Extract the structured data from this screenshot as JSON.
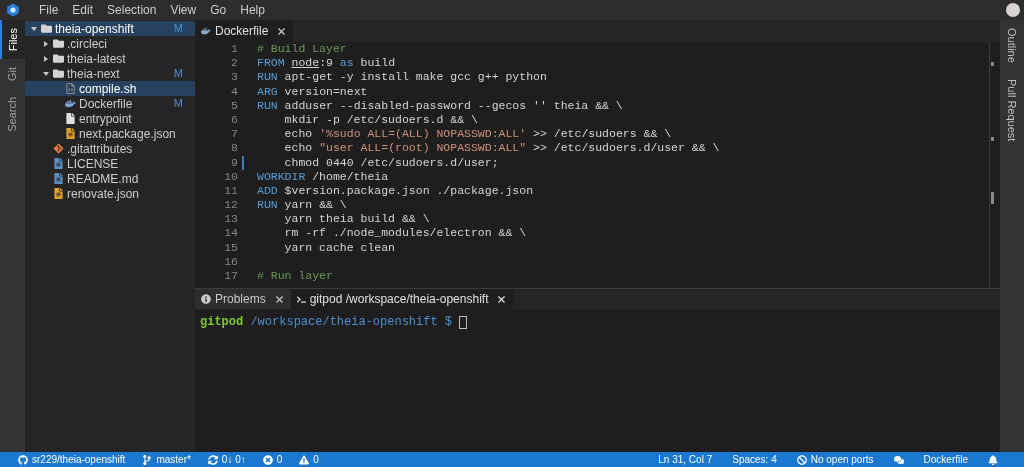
{
  "menu": [
    "File",
    "Edit",
    "Selection",
    "View",
    "Go",
    "Help"
  ],
  "left_tabs": [
    {
      "label": "Files",
      "selected": true
    },
    {
      "label": "Git",
      "selected": false
    },
    {
      "label": "Search",
      "selected": false
    }
  ],
  "right_tabs": [
    {
      "label": "Outline"
    },
    {
      "label": "Pull Request"
    }
  ],
  "tree": [
    {
      "name": "theia-openshift",
      "kind": "folder",
      "expanded": true,
      "selected": true,
      "badge": "M",
      "children": [
        {
          "name": ".circleci",
          "kind": "folder",
          "expanded": false,
          "selected": false
        },
        {
          "name": "theia-latest",
          "kind": "folder",
          "expanded": false,
          "selected": false
        },
        {
          "name": "theia-next",
          "kind": "folder",
          "expanded": true,
          "selected": false,
          "badge": "M",
          "children": [
            {
              "name": "compile.sh",
              "kind": "shell",
              "selected": true
            },
            {
              "name": "Dockerfile",
              "kind": "docker",
              "selected": false,
              "badge": "M"
            },
            {
              "name": "entrypoint",
              "kind": "file",
              "selected": false
            },
            {
              "name": "next.package.json",
              "kind": "json",
              "selected": false
            }
          ]
        },
        {
          "name": ".gitattributes",
          "kind": "git",
          "selected": false
        },
        {
          "name": "LICENSE",
          "kind": "text",
          "selected": false
        },
        {
          "name": "README.md",
          "kind": "text",
          "selected": false
        },
        {
          "name": "renovate.json",
          "kind": "json",
          "selected": false
        }
      ]
    }
  ],
  "editor_tab": {
    "label": "Dockerfile"
  },
  "code_lines": [
    {
      "number": "1",
      "segments": [
        {
          "kind": "comment",
          "text": "# Build Layer"
        }
      ]
    },
    {
      "number": "2",
      "segments": [
        {
          "kind": "keyword",
          "text": "FROM "
        },
        {
          "kind": "link",
          "text": "node"
        },
        {
          "kind": "plain",
          "text": ":9 "
        },
        {
          "kind": "keyword",
          "text": "as"
        },
        {
          "kind": "plain",
          "text": " build"
        }
      ]
    },
    {
      "number": "3",
      "segments": [
        {
          "kind": "keyword",
          "text": "RUN"
        },
        {
          "kind": "plain",
          "text": " apt-get -y install make gcc g++ python"
        }
      ]
    },
    {
      "number": "4",
      "segments": [
        {
          "kind": "keyword",
          "text": "ARG"
        },
        {
          "kind": "plain",
          "text": " version=next"
        }
      ]
    },
    {
      "number": "5",
      "segments": [
        {
          "kind": "keyword",
          "text": "RUN"
        },
        {
          "kind": "plain",
          "text": " adduser --disabled-password --gecos '' theia && \\"
        }
      ]
    },
    {
      "number": "6",
      "segments": [
        {
          "kind": "plain",
          "text": "    mkdir -p /etc/sudoers.d && \\"
        }
      ]
    },
    {
      "number": "7",
      "segments": [
        {
          "kind": "plain",
          "text": "    echo "
        },
        {
          "kind": "string",
          "text": "'%sudo ALL=(ALL) NOPASSWD:ALL'"
        },
        {
          "kind": "plain",
          "text": " >> /etc/sudoers && \\"
        }
      ]
    },
    {
      "number": "8",
      "segments": [
        {
          "kind": "plain",
          "text": "    echo "
        },
        {
          "kind": "string",
          "text": "\"user ALL=(root) NOPASSWD:ALL\""
        },
        {
          "kind": "plain",
          "text": " >> /etc/sudoers.d/user && \\"
        }
      ]
    },
    {
      "number": "9",
      "modified": true,
      "segments": [
        {
          "kind": "plain",
          "text": "    chmod 0440 /etc/sudoers.d/user;"
        }
      ]
    },
    {
      "number": "10",
      "segments": [
        {
          "kind": "keyword",
          "text": "WORKDIR"
        },
        {
          "kind": "plain",
          "text": " /home/theia"
        }
      ]
    },
    {
      "number": "11",
      "segments": [
        {
          "kind": "keyword",
          "text": "ADD"
        },
        {
          "kind": "plain",
          "text": " $version.package.json ./package.json"
        }
      ]
    },
    {
      "number": "12",
      "segments": [
        {
          "kind": "keyword",
          "text": "RUN"
        },
        {
          "kind": "plain",
          "text": " yarn && \\"
        }
      ]
    },
    {
      "number": "13",
      "segments": [
        {
          "kind": "plain",
          "text": "    yarn theia build && \\"
        }
      ]
    },
    {
      "number": "14",
      "segments": [
        {
          "kind": "plain",
          "text": "    rm -rf ./node_modules/electron && \\"
        }
      ]
    },
    {
      "number": "15",
      "segments": [
        {
          "kind": "plain",
          "text": "    yarn cache clean"
        }
      ]
    },
    {
      "number": "16"
    },
    {
      "number": "17",
      "segments": [
        {
          "kind": "comment",
          "text": "# Run layer"
        }
      ]
    }
  ],
  "panel_tabs": [
    {
      "label": "Problems",
      "kind": "problems",
      "selected": false
    },
    {
      "label": "gitpod /workspace/theia-openshift",
      "kind": "terminal",
      "selected": true
    }
  ],
  "terminal": {
    "user": "gitpod",
    "path": "/workspace/theia-openshift $"
  },
  "status_left": [
    {
      "kind": "github",
      "text": "sr229/theia-openshift"
    },
    {
      "kind": "branch",
      "text": "master*"
    },
    {
      "kind": "sync",
      "text": "0↓ 0↑"
    },
    {
      "kind": "errors",
      "text": "0"
    },
    {
      "kind": "warnings",
      "text": "0"
    }
  ],
  "status_right": [
    {
      "kind": "text",
      "text": "Ln 31, Col 7"
    },
    {
      "kind": "text",
      "text": "Spaces: 4"
    },
    {
      "kind": "ports",
      "text": "No open ports"
    },
    {
      "kind": "chat"
    },
    {
      "kind": "text",
      "text": "Dockerfile"
    },
    {
      "kind": "bell"
    }
  ]
}
